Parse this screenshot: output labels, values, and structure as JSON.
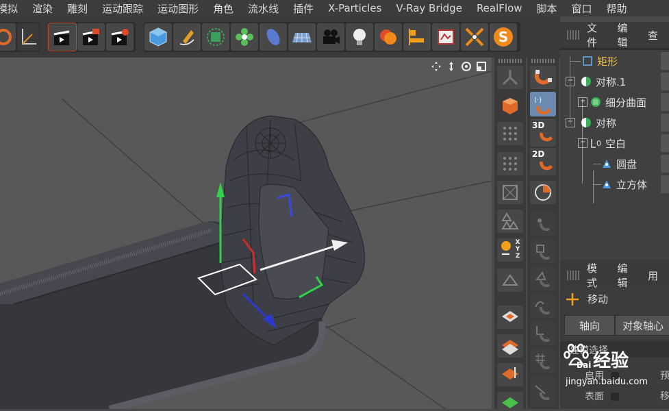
{
  "menubar": [
    "模拟",
    "渲染",
    "雕刻",
    "运动跟踪",
    "运动图形",
    "角色",
    "流水线",
    "插件",
    "X-Particles",
    "V-Ray Bridge",
    "RealFlow",
    "脚本",
    "窗口",
    "帮助"
  ],
  "object_manager": {
    "menu": [
      "文件",
      "编辑",
      "查"
    ],
    "objects": [
      {
        "name": "矩形",
        "selected": true
      },
      {
        "name": "对称.1",
        "selected": false
      },
      {
        "name": "细分曲面",
        "selected": false
      },
      {
        "name": "对称",
        "selected": false
      },
      {
        "name": "空白",
        "selected": false
      },
      {
        "name": "圆盘",
        "selected": false
      },
      {
        "name": "立方体",
        "selected": false
      }
    ]
  },
  "attributes_manager": {
    "menu": [
      "模式",
      "编辑",
      "用"
    ],
    "mode_label": "移动",
    "tabs": [
      "轴向",
      "对象轴心"
    ],
    "section_label": "建模选择",
    "rows": [
      {
        "label": "启用",
        "extra": "预"
      },
      {
        "label": "表面",
        "extra": "移"
      }
    ]
  },
  "column_labels": {
    "c3d": "3D",
    "c2d": "2D",
    "xyz_x": "X",
    "xyz_y": "Y",
    "xyz_z": "Z"
  },
  "watermark": {
    "brand": "经验",
    "url": "jingyan.baidu.com",
    "logo": "Bai"
  },
  "colors": {
    "accent": "#f0c040",
    "menubar": "#3c3c3c",
    "viewport": "#585858",
    "panel": "#404040"
  }
}
